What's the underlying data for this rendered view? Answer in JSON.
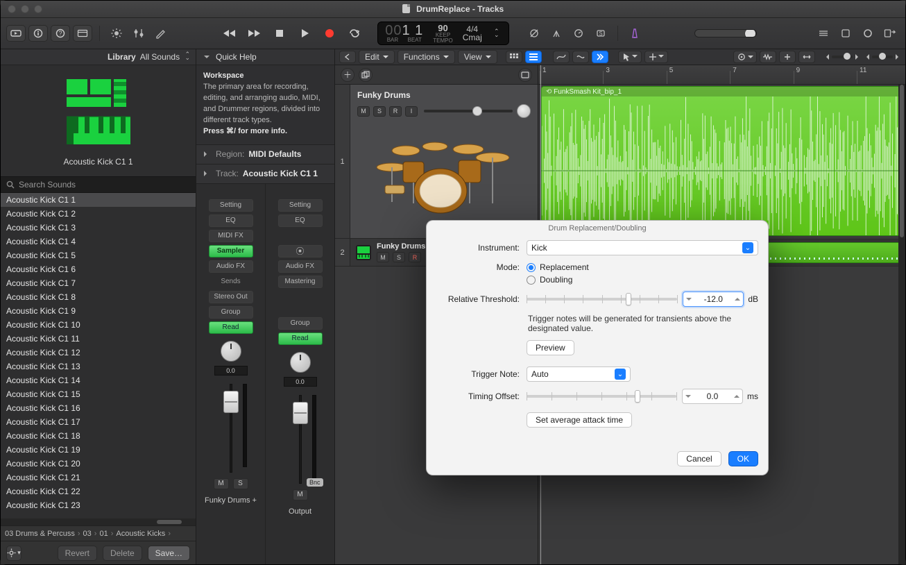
{
  "window": {
    "title": "DrumReplace - Tracks"
  },
  "library": {
    "header_label": "Library",
    "filter": "All Sounds",
    "patch_name": "Acoustic Kick C1 1",
    "search_placeholder": "Search Sounds",
    "sounds": [
      "Acoustic Kick C1 1",
      "Acoustic Kick C1 2",
      "Acoustic Kick C1 3",
      "Acoustic Kick C1 4",
      "Acoustic Kick C1 5",
      "Acoustic Kick C1 6",
      "Acoustic Kick C1 7",
      "Acoustic Kick C1 8",
      "Acoustic Kick C1 9",
      "Acoustic Kick C1 10",
      "Acoustic Kick C1 11",
      "Acoustic Kick C1 12",
      "Acoustic Kick C1 13",
      "Acoustic Kick C1 14",
      "Acoustic Kick C1 15",
      "Acoustic Kick C1 16",
      "Acoustic Kick C1 17",
      "Acoustic Kick C1 18",
      "Acoustic Kick C1 19",
      "Acoustic Kick C1 20",
      "Acoustic Kick C1 21",
      "Acoustic Kick C1 22",
      "Acoustic Kick C1 23"
    ],
    "breadcrumb": [
      "03 Drums & Percuss",
      "03",
      "01",
      "Acoustic Kicks"
    ],
    "revert": "Revert",
    "delete": "Delete",
    "save": "Save…"
  },
  "quickhelp": {
    "title": "Quick Help",
    "heading": "Workspace",
    "text": "The primary area for recording, editing, and arranging audio, MIDI, and Drummer regions, divided into different track types.",
    "more": "Press ⌘/ for more info."
  },
  "inspector": {
    "region_label": "Region:",
    "region_value": "MIDI Defaults",
    "track_label": "Track:",
    "track_value": "Acoustic Kick C1 1",
    "strip_a": {
      "setting": "Setting",
      "eq": "EQ",
      "midifx": "MIDI FX",
      "instrument": "Sampler",
      "audiofx": "Audio FX",
      "sends": "Sends",
      "output": "Stereo Out",
      "group": "Group",
      "automation": "Read",
      "pan": "0.0",
      "mute": "M",
      "solo": "S",
      "name": "Funky Drums +"
    },
    "strip_b": {
      "setting": "Setting",
      "eq": "EQ",
      "stereo": "⦿",
      "audiofx": "Audio FX",
      "mastering": "Mastering",
      "group": "Group",
      "automation": "Read",
      "pan": "0.0",
      "bnc": "Bnc",
      "mute": "M",
      "name": "Output"
    }
  },
  "lcd": {
    "bars_dim": "00",
    "bars": "1 1",
    "bar_label": "BAR",
    "beat_label": "BEAT",
    "tempo": "90",
    "keep": "KEEP",
    "tempo_label": "TEMPO",
    "sig": "4/4",
    "key": "Cmaj"
  },
  "tracks_toolbar": {
    "edit": "Edit",
    "functions": "Functions",
    "view": "View"
  },
  "ruler": {
    "bars": [
      "1",
      "3",
      "5",
      "7",
      "9",
      "11"
    ]
  },
  "track1": {
    "num": "1",
    "name": "Funky Drums",
    "M": "M",
    "S": "S",
    "R": "R",
    "I": "I",
    "region_name": "FunkSmash Kit_bip_1"
  },
  "track2": {
    "num": "2",
    "name": "Funky Drums",
    "M": "M",
    "S": "S",
    "R": "R"
  },
  "modal": {
    "title": "Drum Replacement/Doubling",
    "instrument_label": "Instrument:",
    "instrument_value": "Kick",
    "mode_label": "Mode:",
    "mode_replacement": "Replacement",
    "mode_doubling": "Doubling",
    "threshold_label": "Relative Threshold:",
    "threshold_value": "-12.0",
    "threshold_unit": "dB",
    "help": "Trigger notes will be generated for transients above the designated value.",
    "preview": "Preview",
    "trigger_label": "Trigger Note:",
    "trigger_value": "Auto",
    "timing_label": "Timing Offset:",
    "timing_value": "0.0",
    "timing_unit": "ms",
    "set_avg": "Set average attack time",
    "cancel": "Cancel",
    "ok": "OK"
  }
}
